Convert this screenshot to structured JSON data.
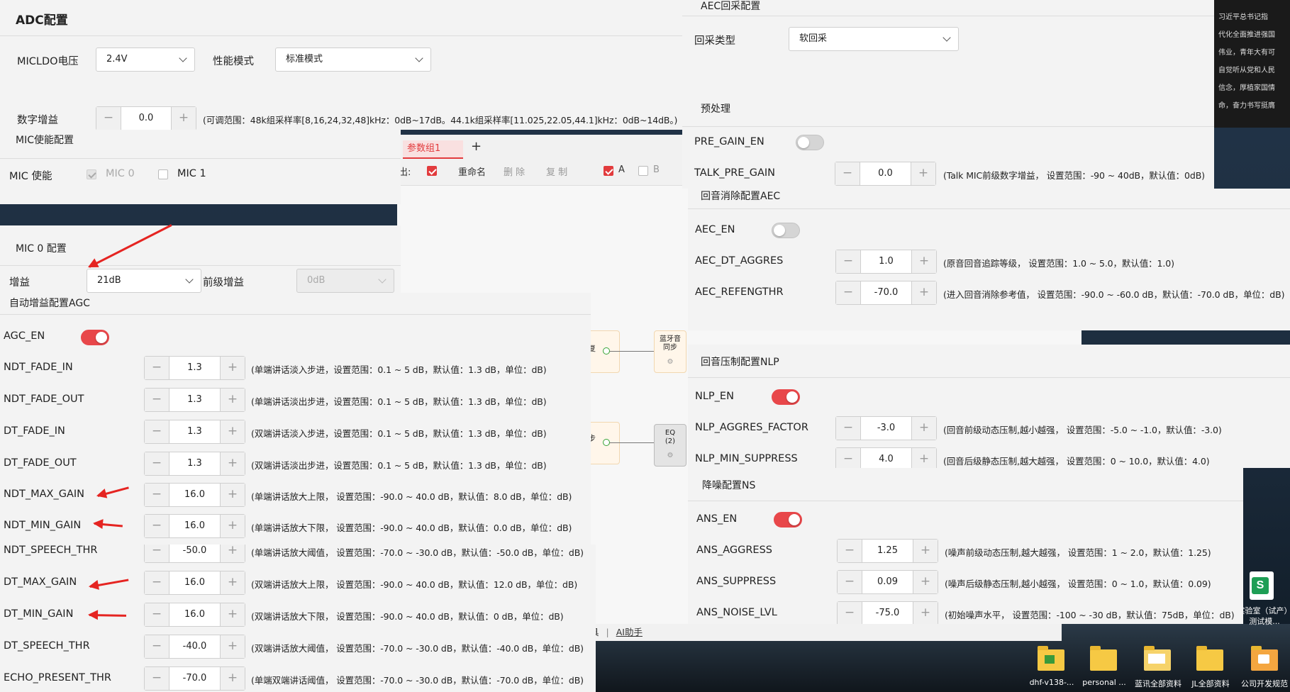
{
  "adc": {
    "title": "ADC配置",
    "micldo_label": "MICLDO电压",
    "micldo_value": "2.4V",
    "perf_label": "性能模式",
    "perf_value": "标准模式",
    "gain_label": "数字增益",
    "gain_value": "0.0",
    "gain_hint": "(可调范围：48k组采样率[8,16,24,32,48]kHz：0dB~17dB。44.1k组采样率[11.025,22.05,44.1]kHz：0dB~14dB。)"
  },
  "mic_enable": {
    "title": "MIC使能配置",
    "label": "MIC 使能",
    "mic0": "MIC 0",
    "mic1": "MIC 1"
  },
  "mic0": {
    "title": "MIC 0 配置",
    "gain_label": "增益",
    "gain_value": "21dB",
    "pre_gain_label": "前级增益",
    "pre_gain_value": "0dB"
  },
  "bg": {
    "tab": "参数组1",
    "add": "+",
    "export": "出:",
    "rename": "重命名",
    "delete": "删 除",
    "copy": "复 制",
    "a": "A",
    "b": "B",
    "node1": "蓝牙音频同步",
    "node1_short": "蓝牙音",
    "node1_sub": "同步",
    "node2": "EQ",
    "node2_sub": "(2)",
    "partial1": "复",
    "partial2": "步",
    "links_tool": "具",
    "links_ai": "AI助手"
  },
  "agc": {
    "title": "自动增益配置AGC",
    "en_label": "AGC_EN",
    "rows": [
      {
        "name": "NDT_FADE_IN",
        "value": "1.3",
        "hint": "(单端讲话淡入步进，设置范围：0.1 ~ 5 dB，默认值：1.3 dB，单位：dB)"
      },
      {
        "name": "NDT_FADE_OUT",
        "value": "1.3",
        "hint": "(单端讲话淡出步进，设置范围：0.1 ~ 5 dB，默认值：1.3 dB，单位：dB)"
      },
      {
        "name": "DT_FADE_IN",
        "value": "1.3",
        "hint": "(双端讲话淡入步进，设置范围：0.1 ~ 5 dB，默认值：1.3 dB，单位：dB)"
      },
      {
        "name": "DT_FADE_OUT",
        "value": "1.3",
        "hint": "(双端讲话淡出步进，设置范围：0.1 ~ 5 dB，默认值：1.3 dB，单位：dB)"
      },
      {
        "name": "NDT_MAX_GAIN",
        "value": "16.0",
        "hint": "(单端讲话放大上限， 设置范围：-90.0 ~ 40.0 dB，默认值：8.0 dB，单位：dB)"
      },
      {
        "name": "NDT_MIN_GAIN",
        "value": "16.0",
        "hint": "(单端讲话放大下限， 设置范围：-90.0 ~ 40.0 dB，默认值：0.0 dB，单位：dB)"
      }
    ]
  },
  "agc2": {
    "rows": [
      {
        "name": "NDT_SPEECH_THR",
        "value": "-50.0",
        "hint": "(单端讲话放大阈值， 设置范围：-70.0 ~ -30.0 dB，默认值：-50.0 dB，单位：dB)"
      },
      {
        "name": "DT_MAX_GAIN",
        "value": "16.0",
        "hint": "(双端讲话放大上限， 设置范围：-90.0 ~ 40.0 dB，默认值：12.0 dB，单位：dB)"
      },
      {
        "name": "DT_MIN_GAIN",
        "value": "16.0",
        "hint": "(双端讲话放大下限， 设置范围：-90.0 ~ 40.0 dB，默认值：0 dB，单位：dB)"
      },
      {
        "name": "DT_SPEECH_THR",
        "value": "-40.0",
        "hint": "(双端讲话放大阈值， 设置范围：-70.0 ~ -30.0 dB，默认值：-40.0 dB，单位：dB)"
      },
      {
        "name": "ECHO_PRESENT_THR",
        "value": "-70.0",
        "hint": "(单端双端讲话阈值， 设置范围：-70.0 ~ -30.0 dB，默认值：-70.0 dB，单位：dB)"
      }
    ]
  },
  "aec": {
    "title": "AEC回采配置",
    "type_label": "回采类型",
    "type_value": "软回采"
  },
  "pre": {
    "title": "预处理",
    "en_label": "PRE_GAIN_EN",
    "talk_label": "TALK_PRE_GAIN",
    "talk_value": "0.0",
    "talk_hint": "(Talk MIC前级数字增益， 设置范围：-90 ~ 40dB，默认值：0dB)"
  },
  "aec2": {
    "title": "回音消除配置AEC",
    "en_label": "AEC_EN",
    "rows": [
      {
        "name": "AEC_DT_AGGRES",
        "value": "1.0",
        "hint": "(原音回音追踪等级， 设置范围：1.0 ~ 5.0，默认值：1.0)"
      },
      {
        "name": "AEC_REFENGTHR",
        "value": "-70.0",
        "hint": "(进入回音消除参考值， 设置范围：-90.0 ~ -60.0 dB，默认值：-70.0 dB，单位：dB)"
      }
    ]
  },
  "nlp": {
    "title": "回音压制配置NLP",
    "en_label": "NLP_EN",
    "rows": [
      {
        "name": "NLP_AGGRES_FACTOR",
        "value": "-3.0",
        "hint": "(回音前级动态压制,越小越强， 设置范围：-5.0 ~ -1.0，默认值：-3.0)"
      },
      {
        "name": "NLP_MIN_SUPPRESS",
        "value": "4.0",
        "hint": "(回音后级静态压制,越大越强， 设置范围：0 ~ 10.0，默认值：4.0)"
      }
    ]
  },
  "ns": {
    "title": "降噪配置NS",
    "en_label": "ANS_EN",
    "rows": [
      {
        "name": "ANS_AGGRESS",
        "value": "1.25",
        "hint": "(噪声前级动态压制,越大越强， 设置范围：1 ~ 2.0，默认值：1.25)"
      },
      {
        "name": "ANS_SUPPRESS",
        "value": "0.09",
        "hint": "(噪声后级静态压制,越小越强， 设置范围：0 ~ 1.0，默认值：0.09)"
      },
      {
        "name": "ANS_NOISE_LVL",
        "value": "-75.0",
        "hint": "(初始噪声水平， 设置范围：-100 ~ -30 dB，默认值：75dB，单位：dB)"
      }
    ]
  },
  "desktop": {
    "calligraphy": [
      "习近平总书记指",
      "代化全面推进强国",
      "伟业，青年大有可",
      "自觉听从党和人民",
      "信念，厚植家国情",
      "命，奋力书写挺膺"
    ],
    "icons": [
      "dhf-v138-...",
      "personal ...",
      "蓝讯全部资料",
      "JL全部资料",
      "公司开发规范"
    ],
    "lab": "实验室（试产）测试模..."
  }
}
